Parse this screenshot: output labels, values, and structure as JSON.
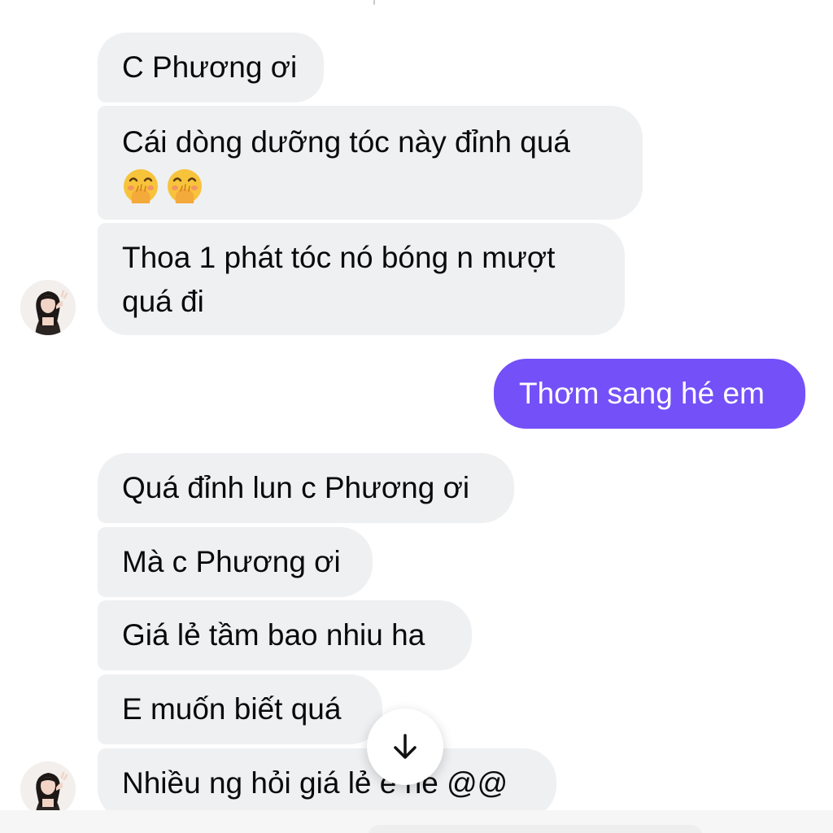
{
  "conversation": {
    "messages": [
      {
        "from": "contact",
        "text": "C Phương ơi"
      },
      {
        "from": "contact",
        "lines": [
          "Cái dòng dưỡng tóc này đỉnh quá"
        ],
        "emojis": [
          "face-with-hand-over-mouth",
          "face-with-hand-over-mouth"
        ]
      },
      {
        "from": "contact",
        "lines": [
          "Thoa 1 phát tóc nó bóng n mượt",
          "quá đi"
        ]
      },
      {
        "from": "me",
        "text": "Thơm sang hé em"
      },
      {
        "from": "contact",
        "text": "Quá đỉnh lun c Phương ơi"
      },
      {
        "from": "contact",
        "text": "Mà c Phương ơi"
      },
      {
        "from": "contact",
        "text": "Giá lẻ tầm bao nhiu ha"
      },
      {
        "from": "contact",
        "text": "E muốn biết quá"
      },
      {
        "from": "contact",
        "text": "Nhiều ng hỏi giá lẻ e ne @@"
      }
    ]
  },
  "colors": {
    "incoming_bubble": "#eff0f2",
    "outgoing_bubble": "#7450f8",
    "outgoing_text": "#ffffff",
    "incoming_text": "#0a0a0a"
  },
  "icons": {
    "scroll_down": "arrow-down-icon",
    "avatar": "contact-avatar"
  }
}
